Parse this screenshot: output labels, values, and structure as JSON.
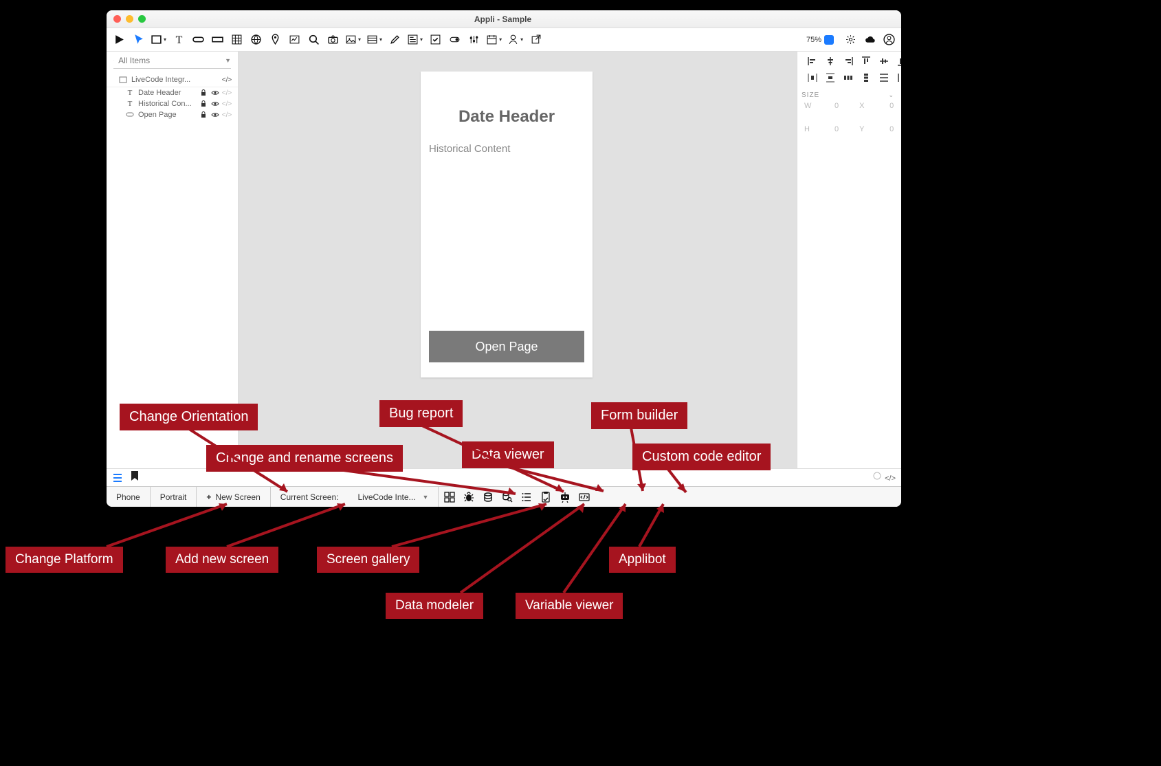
{
  "window": {
    "title": "Appli - Sample"
  },
  "toolbar": {
    "zoom_label": "75%"
  },
  "sidebar": {
    "search_placeholder": "All Items",
    "items": [
      {
        "label": "LiveCode Integr...",
        "has_lock": false
      },
      {
        "label": "Date Header",
        "has_lock": true
      },
      {
        "label": "Historical Con...",
        "has_lock": true
      },
      {
        "label": "Open Page",
        "has_lock": true
      }
    ]
  },
  "canvas": {
    "heading": "Date Header",
    "body_text": "Historical Content",
    "button_label": "Open Page"
  },
  "inspector": {
    "size_label": "SIZE",
    "w_label": "W",
    "w_value": "0",
    "x_label": "X",
    "x_value": "0",
    "h_label": "H",
    "h_value": "0",
    "y_label": "Y",
    "y_value": "0"
  },
  "bottombar": {
    "platform": "Phone",
    "orientation": "Portrait",
    "new_screen": "New Screen",
    "current_label": "Current Screen:",
    "current_value": "LiveCode Inte..."
  },
  "callouts": {
    "change_orientation": "Change Orientation",
    "change_rename": "Change and rename screens",
    "bug_report": "Bug report",
    "data_viewer": "Data viewer",
    "form_builder": "Form builder",
    "custom_code": "Custom code editor",
    "change_platform": "Change Platform",
    "add_new_screen": "Add new screen",
    "screen_gallery": "Screen gallery",
    "data_modeler": "Data modeler",
    "variable_viewer": "Variable viewer",
    "applibot": "Applibot"
  }
}
